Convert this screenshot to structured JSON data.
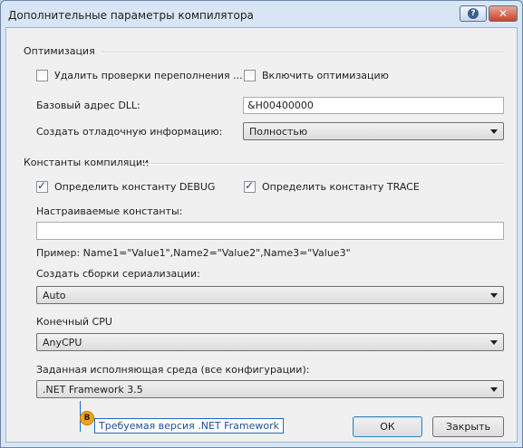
{
  "window": {
    "title": "Дополнительные параметры компилятора",
    "help_glyph": "?",
    "close_glyph": "✕"
  },
  "optimization": {
    "group_label": "Оптимизация",
    "remove_overflow_checks": {
      "label": "Удалить проверки переполнения ...",
      "checked": false
    },
    "enable_optimizations": {
      "label": "Включить оптимизацию",
      "checked": false
    },
    "dll_base_label": "Базовый адрес DLL:",
    "dll_base_value": "&H00400000",
    "debug_info_label": "Создать отладочную информацию:",
    "debug_info_value": "Полностью"
  },
  "constants": {
    "group_label": "Константы компиляции",
    "define_debug": {
      "label": "Определить константу DEBUG",
      "checked": true
    },
    "define_trace": {
      "label": "Определить константу TRACE",
      "checked": true
    },
    "custom_label": "Настраиваемые константы:",
    "custom_value": "",
    "example_text": "Пример: Name1=\"Value1\",Name2=\"Value2\",Name3=\"Value3\""
  },
  "serialization": {
    "label": "Создать сборки сериализации:",
    "value": "Auto"
  },
  "target_cpu": {
    "label": "Конечный CPU",
    "value": "AnyCPU"
  },
  "target_framework": {
    "label": "Заданная исполняющая среда (все конфигурации):",
    "value": ".NET Framework 3.5"
  },
  "buttons": {
    "ok": "ОК",
    "close": "Закрыть"
  },
  "callout": {
    "badge": "B",
    "text": "Требуемая версия .NET Framework",
    "color": "#1b6ac9",
    "badge_color": "#f3a31b"
  }
}
